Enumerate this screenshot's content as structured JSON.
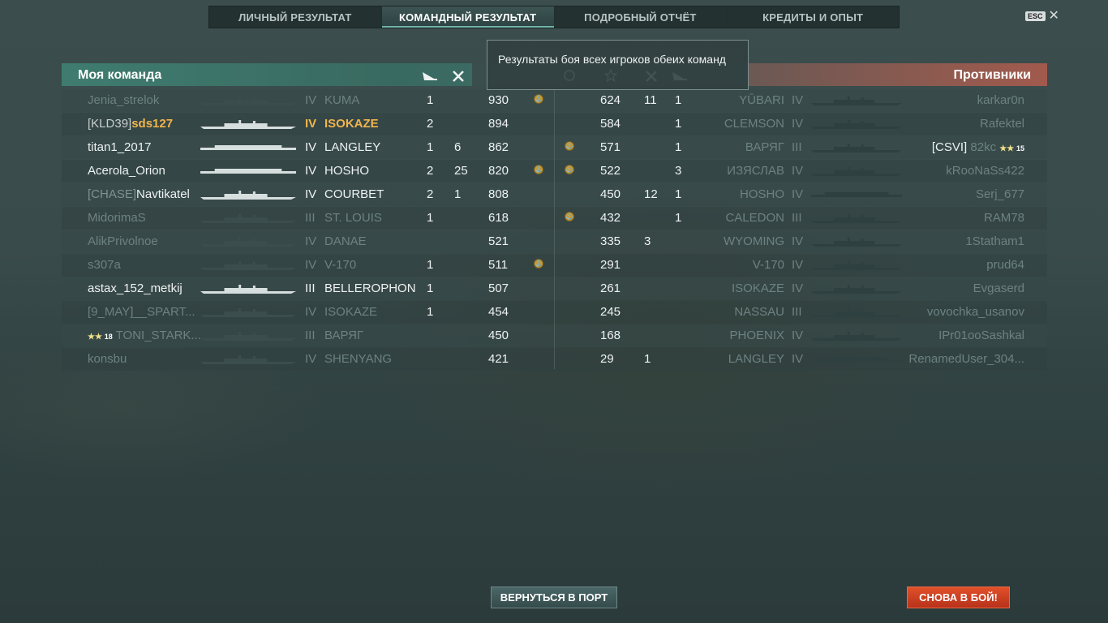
{
  "tabs": [
    {
      "label": "ЛИЧНЫЙ РЕЗУЛЬТАТ",
      "active": false
    },
    {
      "label": "КОМАНДНЫЙ РЕЗУЛЬТАТ",
      "active": true
    },
    {
      "label": "ПОДРОБНЫЙ ОТЧЁТ",
      "active": false
    },
    {
      "label": "КРЕДИТЫ И ОПЫТ",
      "active": false
    }
  ],
  "esc_label": "ESC",
  "close_glyph": "✕",
  "my_team_title": "Моя команда",
  "enemy_team_title": "Противники",
  "tooltip": "Результаты боя всех игроков обеих команд",
  "column_icons": [
    "plane-icon",
    "cross-icon",
    "star-icon",
    "medal-icon"
  ],
  "left_rows": [
    {
      "clan": "",
      "name": "Jenia_strelok",
      "tier": "IV",
      "ship": "KUMA",
      "a": "1",
      "b": "",
      "xp": "930",
      "medal": true,
      "style": "dim"
    },
    {
      "clan": "[KLD39]",
      "name": "sds127",
      "tier": "IV",
      "ship": "ISOKAZE",
      "a": "2",
      "b": "",
      "xp": "894",
      "medal": false,
      "style": "gold"
    },
    {
      "clan": "",
      "name": "titan1_2017",
      "tier": "IV",
      "ship": "LANGLEY",
      "a": "1",
      "b": "6",
      "xp": "862",
      "medal": false,
      "style": "bright"
    },
    {
      "clan": "",
      "name": "Acerola_Orion",
      "tier": "IV",
      "ship": "HOSHO",
      "a": "2",
      "b": "25",
      "xp": "820",
      "medal": true,
      "style": "bright"
    },
    {
      "clan": "[CHASE]",
      "name": "Navtikatel",
      "tier": "IV",
      "ship": "COURBET",
      "a": "2",
      "b": "1",
      "xp": "808",
      "medal": false,
      "style": "bright"
    },
    {
      "clan": "",
      "name": "MidorimaS",
      "tier": "III",
      "ship": "ST. LOUIS",
      "a": "1",
      "b": "",
      "xp": "618",
      "medal": false,
      "style": "dim"
    },
    {
      "clan": "",
      "name": "AlikPrivolnoe",
      "tier": "IV",
      "ship": "DANAE",
      "a": "",
      "b": "",
      "xp": "521",
      "medal": false,
      "style": "dim"
    },
    {
      "clan": "",
      "name": "s307a",
      "tier": "IV",
      "ship": "V-170",
      "a": "1",
      "b": "",
      "xp": "511",
      "medal": true,
      "style": "dim"
    },
    {
      "clan": "",
      "name": "astax_152_metkij",
      "tier": "III",
      "ship": "BELLEROPHON",
      "a": "1",
      "b": "",
      "xp": "507",
      "medal": false,
      "style": "bright"
    },
    {
      "clan": "",
      "name": "[9_MAY]__SPART...",
      "tier": "IV",
      "ship": "ISOKAZE",
      "a": "1",
      "b": "",
      "xp": "454",
      "medal": false,
      "style": "dim"
    },
    {
      "clan": "",
      "name": "TONI_STARK...",
      "tier": "III",
      "ship": "ВАРЯГ",
      "a": "",
      "b": "",
      "xp": "450",
      "medal": false,
      "style": "dim",
      "rank": "18"
    },
    {
      "clan": "",
      "name": "konsbu",
      "tier": "IV",
      "ship": "SHENYANG",
      "a": "",
      "b": "",
      "xp": "421",
      "medal": false,
      "style": "dim"
    }
  ],
  "right_rows": [
    {
      "xp": "624",
      "a": "11",
      "b": "1",
      "ship": "YŪBARI",
      "tier": "IV",
      "name": "karkar0n",
      "clan": "",
      "medal": false
    },
    {
      "xp": "584",
      "a": "",
      "b": "1",
      "ship": "CLEMSON",
      "tier": "IV",
      "name": "Rafektel",
      "clan": "",
      "medal": false
    },
    {
      "xp": "571",
      "a": "",
      "b": "1",
      "ship": "ВАРЯГ",
      "tier": "III",
      "name": "82kc",
      "clan": "[CSVI]",
      "medal": true,
      "rank": "15"
    },
    {
      "xp": "522",
      "a": "",
      "b": "3",
      "ship": "ИЗЯСЛАВ",
      "tier": "IV",
      "name": "kRooNaSs422",
      "clan": "",
      "medal": true
    },
    {
      "xp": "450",
      "a": "12",
      "b": "1",
      "ship": "HOSHO",
      "tier": "IV",
      "name": "Serj_677",
      "clan": "",
      "medal": false
    },
    {
      "xp": "432",
      "a": "",
      "b": "1",
      "ship": "CALEDON",
      "tier": "III",
      "name": "RAM78",
      "clan": "",
      "medal": true
    },
    {
      "xp": "335",
      "a": "3",
      "b": "",
      "ship": "WYOMING",
      "tier": "IV",
      "name": "1Statham1",
      "clan": "",
      "medal": false
    },
    {
      "xp": "291",
      "a": "",
      "b": "",
      "ship": "V-170",
      "tier": "IV",
      "name": "prud64",
      "clan": "",
      "medal": false
    },
    {
      "xp": "261",
      "a": "",
      "b": "",
      "ship": "ISOKAZE",
      "tier": "IV",
      "name": "Evgaserd",
      "clan": "",
      "medal": false
    },
    {
      "xp": "245",
      "a": "",
      "b": "",
      "ship": "NASSAU",
      "tier": "III",
      "name": "vovochka_usanov",
      "clan": "",
      "medal": false
    },
    {
      "xp": "168",
      "a": "",
      "b": "",
      "ship": "PHOENIX",
      "tier": "IV",
      "name": "IPr01ooSashkal",
      "clan": "",
      "medal": false
    },
    {
      "xp": "29",
      "a": "1",
      "b": "",
      "ship": "LANGLEY",
      "tier": "IV",
      "name": "RenamedUser_304...",
      "clan": "",
      "medal": false
    }
  ],
  "buttons": {
    "port": "ВЕРНУТЬСЯ В ПОРТ",
    "battle": "СНОВА В БОЙ!"
  },
  "colors": {
    "accent": "#f2b54b",
    "ally_header": "#3f7c6f",
    "enemy_header": "#a25a4d",
    "battle_button": "#d84a26"
  }
}
